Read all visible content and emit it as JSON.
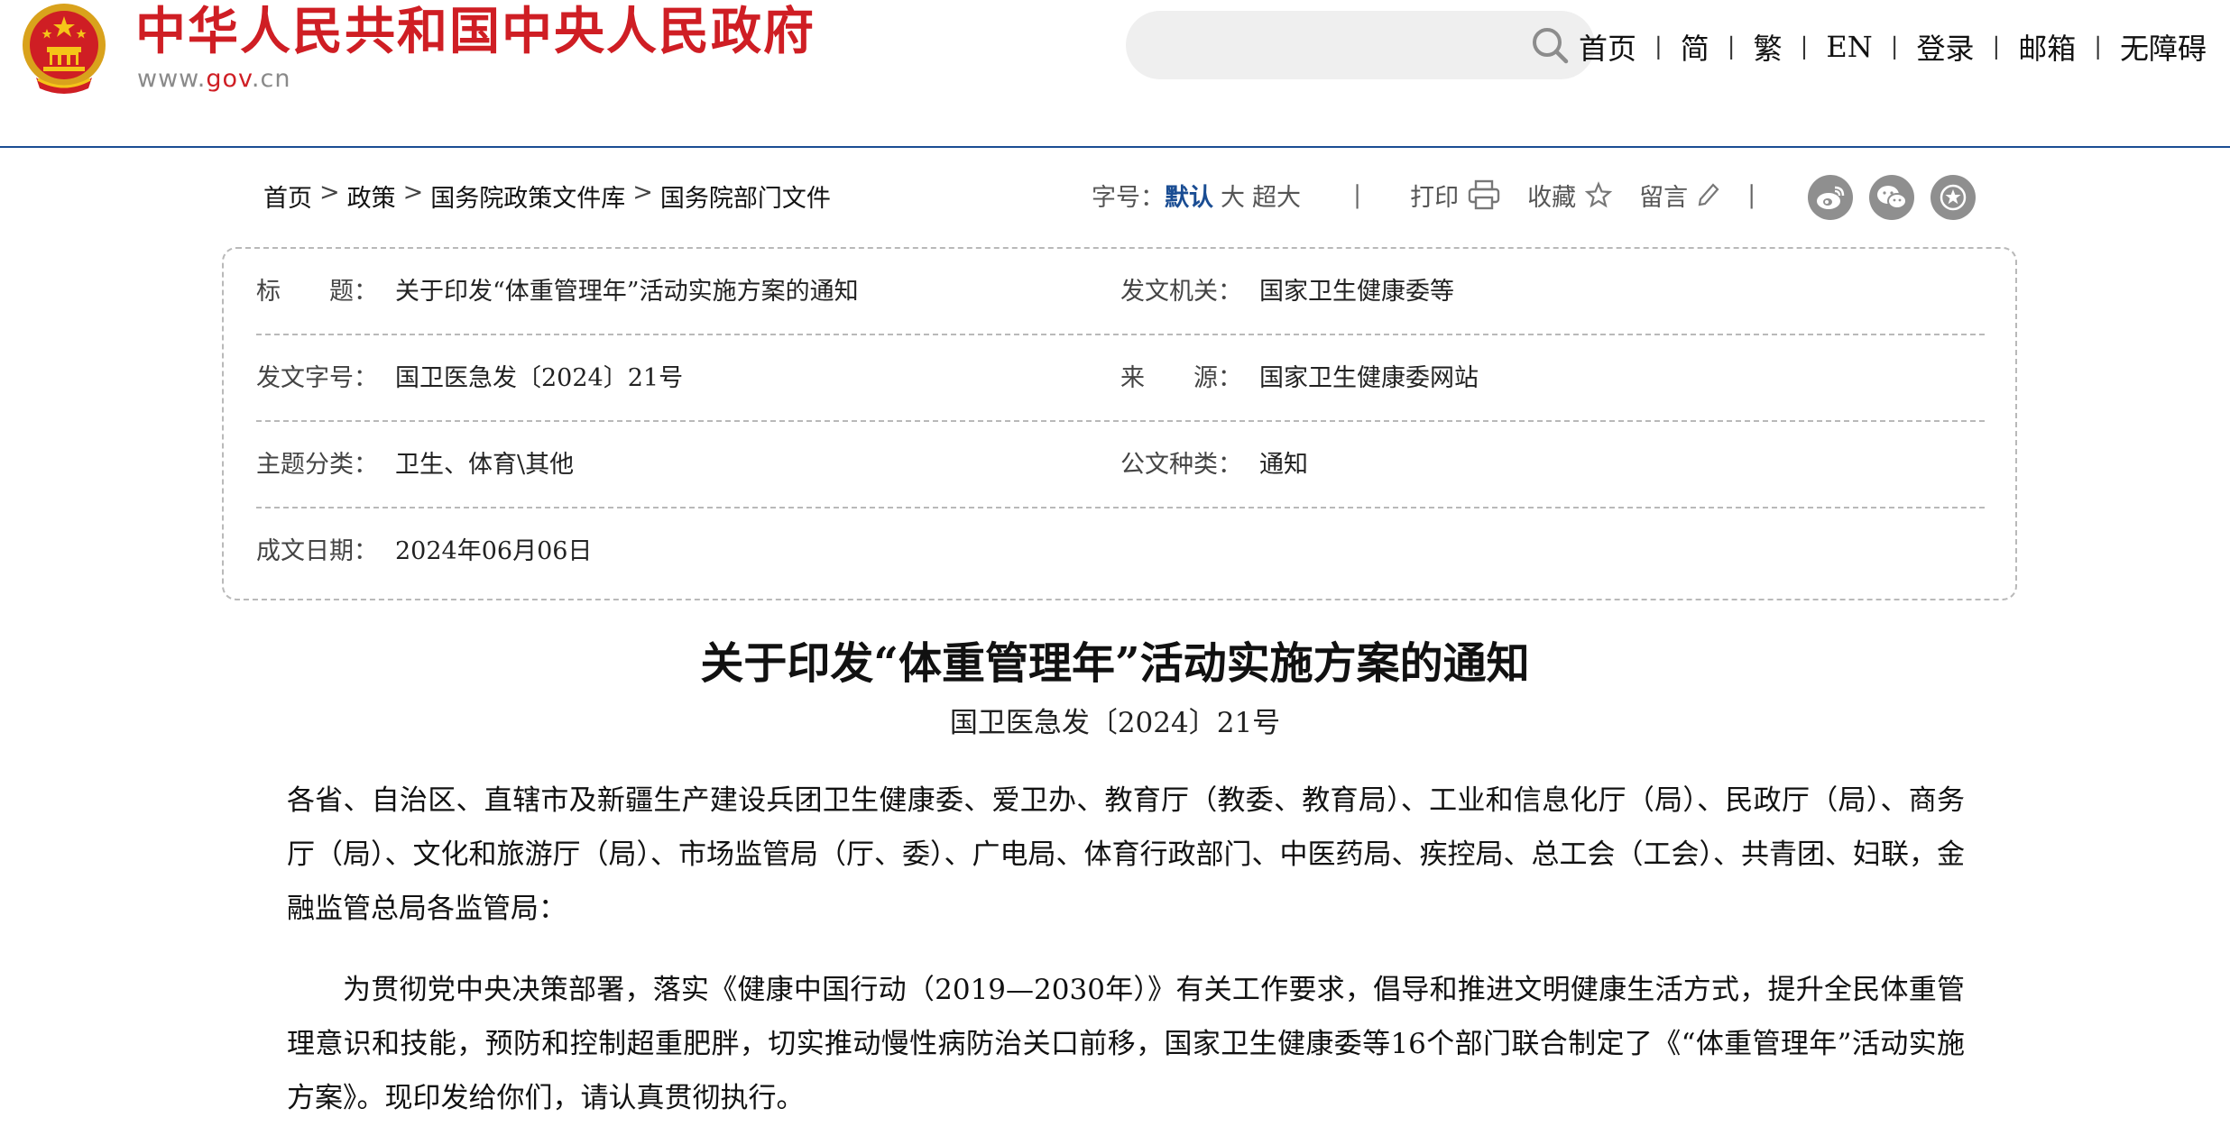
{
  "header": {
    "site_title": "中华人民共和国中央人民政府",
    "site_url_prefix": "www.",
    "site_url_gov": "gov",
    "site_url_suffix": ".cn",
    "search_placeholder": "",
    "nav": [
      "首页",
      "简",
      "繁",
      "EN",
      "登录",
      "邮箱",
      "无障碍"
    ],
    "accent_red": "#cf1e24",
    "accent_blue": "#1a4d93"
  },
  "breadcrumb": [
    "首页",
    "政策",
    "国务院政策文件库",
    "国务院部门文件"
  ],
  "tools": {
    "font_size_label": "字号：",
    "font_default": "默认",
    "font_large": "大",
    "font_xlarge": "超大",
    "print": "打印",
    "favorite": "收藏",
    "comment": "留言"
  },
  "info": {
    "title_label": "标　　题：",
    "title_value": "关于印发“体重管理年”活动实施方案的通知",
    "issuer_label": "发文机关：",
    "issuer_value": "国家卫生健康委等",
    "docno_label": "发文字号：",
    "docno_value": "国卫医急发〔2024〕21号",
    "source_label": "来　　源：",
    "source_value": "国家卫生健康委网站",
    "topic_label": "主题分类：",
    "topic_value": "卫生、体育\\其他",
    "doctype_label": "公文种类：",
    "doctype_value": "通知",
    "date_label": "成文日期：",
    "date_value": "2024年06月06日"
  },
  "article": {
    "title": "关于印发“体重管理年”活动实施方案的通知",
    "doc_number": "国卫医急发〔2024〕21号",
    "addressees": "各省、自治区、直辖市及新疆生产建设兵团卫生健康委、爱卫办、教育厅（教委、教育局）、工业和信息化厅（局）、民政厅（局）、商务厅（局）、文化和旅游厅（局）、市场监管局（厅、委）、广电局、体育行政部门、中医药局、疾控局、总工会（工会）、共青团、妇联，金融监管总局各监管局：",
    "body": "为贯彻党中央决策部署，落实《健康中国行动（2019—2030年）》有关工作要求，倡导和推进文明健康生活方式，提升全民体重管理意识和技能，预防和控制超重肥胖，切实推动慢性病防治关口前移，国家卫生健康委等16个部门联合制定了《“体重管理年”活动实施方案》。现印发给你们，请认真贯彻执行。"
  }
}
